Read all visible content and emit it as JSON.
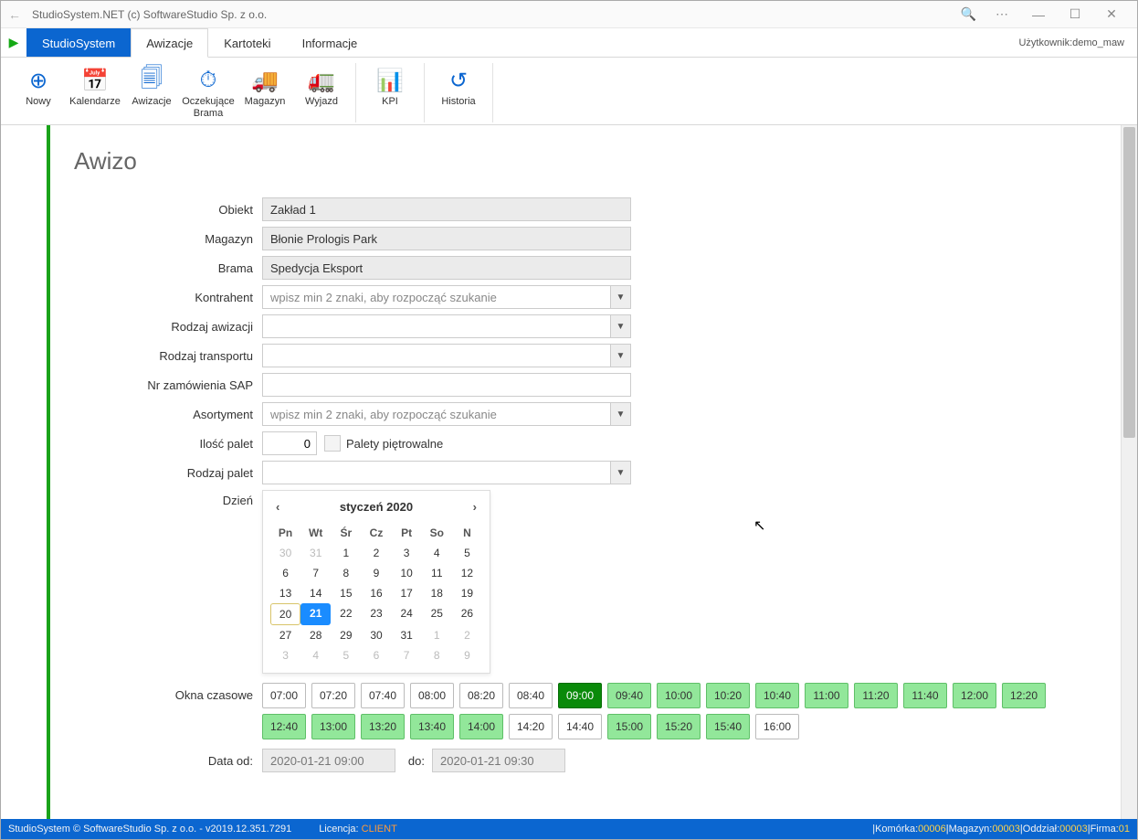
{
  "window": {
    "title": "StudioSystem.NET (c) SoftwareStudio Sp. z o.o."
  },
  "menubar": {
    "tabs": [
      {
        "label": "StudioSystem",
        "kind": "primary"
      },
      {
        "label": "Awizacje",
        "kind": "active"
      },
      {
        "label": "Kartoteki",
        "kind": ""
      },
      {
        "label": "Informacje",
        "kind": ""
      }
    ],
    "user_prefix": "Użytkownik: ",
    "user": "demo_maw"
  },
  "ribbon": {
    "groups": [
      [
        {
          "icon": "⊕",
          "label": "Nowy"
        },
        {
          "icon": "📅",
          "label": "Kalendarze"
        },
        {
          "icon": "🗐",
          "label": "Awizacje"
        },
        {
          "icon": "⏱",
          "label": "Oczekujące Brama"
        },
        {
          "icon": "🚚",
          "label": "Magazyn"
        },
        {
          "icon": "🚛",
          "label": "Wyjazd"
        }
      ],
      [
        {
          "icon": "📊",
          "label": "KPI"
        }
      ],
      [
        {
          "icon": "↺",
          "label": "Historia"
        }
      ]
    ]
  },
  "page": {
    "title": "Awizo"
  },
  "form": {
    "obiekt_label": "Obiekt",
    "obiekt_value": "Zakład 1",
    "magazyn_label": "Magazyn",
    "magazyn_value": "Błonie Prologis Park",
    "brama_label": "Brama",
    "brama_value": "Spedycja Eksport",
    "kontrahent_label": "Kontrahent",
    "kontrahent_placeholder": "wpisz min 2 znaki, aby rozpocząć szukanie",
    "rodzaj_awizacji_label": "Rodzaj awizacji",
    "rodzaj_transportu_label": "Rodzaj transportu",
    "nr_sap_label": "Nr zamówienia SAP",
    "asortyment_label": "Asortyment",
    "asortyment_placeholder": "wpisz min 2 znaki, aby rozpocząć szukanie",
    "ilosc_label": "Ilość palet",
    "ilosc_value": "0",
    "pietrowalne_label": "Palety piętrowalne",
    "rodzaj_palet_label": "Rodzaj palet",
    "dzien_label": "Dzień",
    "okna_label": "Okna czasowe",
    "data_od_label": "Data od:",
    "data_od_value": "2020-01-21 09:00",
    "do_label": "do:",
    "do_value": "2020-01-21 09:30"
  },
  "calendar": {
    "title": "styczeń 2020",
    "dow": [
      "Pn",
      "Wt",
      "Śr",
      "Cz",
      "Pt",
      "So",
      "N"
    ],
    "days": [
      {
        "n": "30",
        "c": "other"
      },
      {
        "n": "31",
        "c": "other"
      },
      {
        "n": "1",
        "c": ""
      },
      {
        "n": "2",
        "c": ""
      },
      {
        "n": "3",
        "c": ""
      },
      {
        "n": "4",
        "c": ""
      },
      {
        "n": "5",
        "c": ""
      },
      {
        "n": "6",
        "c": ""
      },
      {
        "n": "7",
        "c": ""
      },
      {
        "n": "8",
        "c": ""
      },
      {
        "n": "9",
        "c": ""
      },
      {
        "n": "10",
        "c": ""
      },
      {
        "n": "11",
        "c": ""
      },
      {
        "n": "12",
        "c": ""
      },
      {
        "n": "13",
        "c": ""
      },
      {
        "n": "14",
        "c": ""
      },
      {
        "n": "15",
        "c": ""
      },
      {
        "n": "16",
        "c": ""
      },
      {
        "n": "17",
        "c": ""
      },
      {
        "n": "18",
        "c": ""
      },
      {
        "n": "19",
        "c": ""
      },
      {
        "n": "20",
        "c": "today"
      },
      {
        "n": "21",
        "c": "selected"
      },
      {
        "n": "22",
        "c": ""
      },
      {
        "n": "23",
        "c": ""
      },
      {
        "n": "24",
        "c": ""
      },
      {
        "n": "25",
        "c": ""
      },
      {
        "n": "26",
        "c": ""
      },
      {
        "n": "27",
        "c": ""
      },
      {
        "n": "28",
        "c": ""
      },
      {
        "n": "29",
        "c": ""
      },
      {
        "n": "30",
        "c": ""
      },
      {
        "n": "31",
        "c": ""
      },
      {
        "n": "1",
        "c": "other"
      },
      {
        "n": "2",
        "c": "other"
      },
      {
        "n": "3",
        "c": "other"
      },
      {
        "n": "4",
        "c": "other"
      },
      {
        "n": "5",
        "c": "other"
      },
      {
        "n": "6",
        "c": "other"
      },
      {
        "n": "7",
        "c": "other"
      },
      {
        "n": "8",
        "c": "other"
      },
      {
        "n": "9",
        "c": "other"
      }
    ]
  },
  "slots": [
    {
      "t": "07:00",
      "c": "plain"
    },
    {
      "t": "07:20",
      "c": "plain"
    },
    {
      "t": "07:40",
      "c": "plain"
    },
    {
      "t": "08:00",
      "c": "plain"
    },
    {
      "t": "08:20",
      "c": "plain"
    },
    {
      "t": "08:40",
      "c": "plain"
    },
    {
      "t": "09:00",
      "c": "selected"
    },
    {
      "t": "09:40",
      "c": "avail"
    },
    {
      "t": "10:00",
      "c": "avail"
    },
    {
      "t": "10:20",
      "c": "avail"
    },
    {
      "t": "10:40",
      "c": "avail"
    },
    {
      "t": "11:00",
      "c": "avail"
    },
    {
      "t": "11:20",
      "c": "avail"
    },
    {
      "t": "11:40",
      "c": "avail"
    },
    {
      "t": "12:00",
      "c": "avail"
    },
    {
      "t": "12:20",
      "c": "avail"
    },
    {
      "t": "12:40",
      "c": "avail"
    },
    {
      "t": "13:00",
      "c": "avail"
    },
    {
      "t": "13:20",
      "c": "avail"
    },
    {
      "t": "13:40",
      "c": "avail"
    },
    {
      "t": "14:00",
      "c": "avail"
    },
    {
      "t": "14:20",
      "c": "plain"
    },
    {
      "t": "14:40",
      "c": "plain"
    },
    {
      "t": "15:00",
      "c": "avail"
    },
    {
      "t": "15:20",
      "c": "avail"
    },
    {
      "t": "15:40",
      "c": "avail"
    },
    {
      "t": "16:00",
      "c": "plain"
    }
  ],
  "statusbar": {
    "left": "StudioSystem © SoftwareStudio Sp. z o.o. - v2019.12.351.7291",
    "lic_label": "Licencja: ",
    "lic_value": "CLIENT",
    "komorka_label": "Komórka: ",
    "komorka_value": "00006",
    "magazyn_label": "Magazyn: ",
    "magazyn_value": "00003",
    "oddzial_label": "Oddział: ",
    "oddzial_value": "00003",
    "firma_label": "Firma: ",
    "firma_value": "01"
  }
}
